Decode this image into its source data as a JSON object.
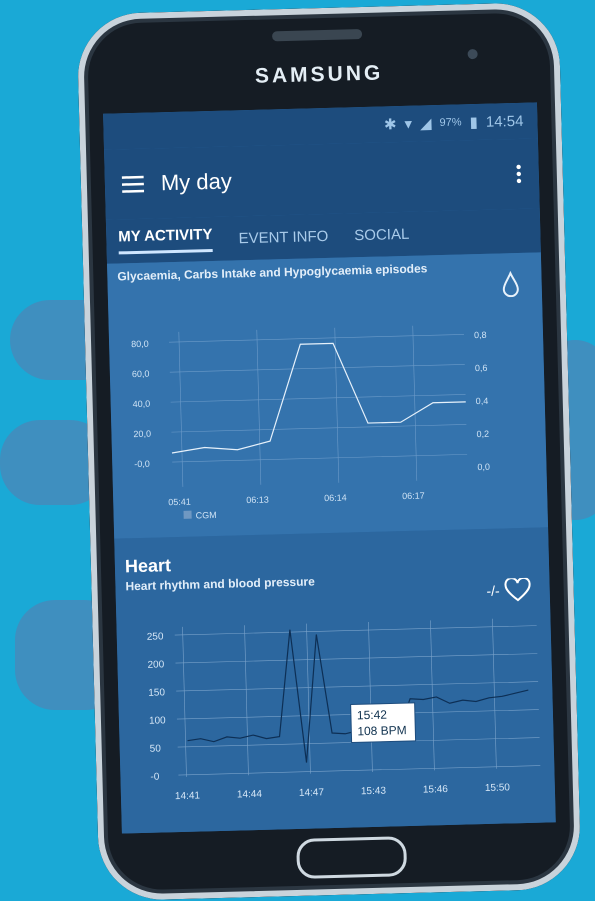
{
  "device": {
    "brand": "SAMSUNG"
  },
  "status": {
    "battery": "97%",
    "time": "14:54"
  },
  "appbar": {
    "title": "My day"
  },
  "tabs": [
    {
      "label": "MY ACTIVITY"
    },
    {
      "label": "EVENT INFO"
    },
    {
      "label": "SOCIAL"
    }
  ],
  "glyc_card": {
    "subtitle": "Glycaemia, Carbs Intake and Hypoglycaemia episodes",
    "icon": "water-drop-icon"
  },
  "heart_card": {
    "title": "Heart",
    "subtitle": "Heart rhythm and blood pressure",
    "indicator": "-/-",
    "icon": "heart-outline-icon"
  },
  "chart_data": [
    {
      "type": "line",
      "title": "Glycaemia, Carbs Intake and Hypoglycaemia episodes",
      "categories": [
        "05:41",
        "06:13",
        "06:14",
        "06:17"
      ],
      "series": [
        {
          "name": "CGM",
          "values": [
            12,
            15,
            13,
            18,
            80,
            80,
            28,
            28,
            40,
            40
          ]
        }
      ],
      "ylim": [
        -10,
        90
      ],
      "yticks": [
        "80,0",
        "60,0",
        "40,0",
        "20,0",
        "-0,0"
      ],
      "y2ticks": [
        "0,8",
        "0,6",
        "0,4",
        "0,2",
        "0,0"
      ],
      "legend": "bottom-left",
      "grid": true
    },
    {
      "type": "line",
      "title": "Heart",
      "categories": [
        "14:41",
        "14:44",
        "14:47",
        "15:43",
        "15:46",
        "15:50"
      ],
      "yticks": [
        "250",
        "200",
        "150",
        "100",
        "50",
        "-0"
      ],
      "ylim": [
        -10,
        260
      ],
      "series": [
        {
          "values": [
            55,
            58,
            52,
            60,
            57,
            62,
            55,
            58,
            250,
            10,
            240,
            62,
            60,
            65,
            58,
            62,
            60,
            120,
            118,
            122,
            110,
            115,
            112,
            118,
            120,
            125,
            130
          ]
        }
      ],
      "tooltip": {
        "time": "15:42",
        "value": "108 BPM"
      },
      "grid": true
    }
  ]
}
